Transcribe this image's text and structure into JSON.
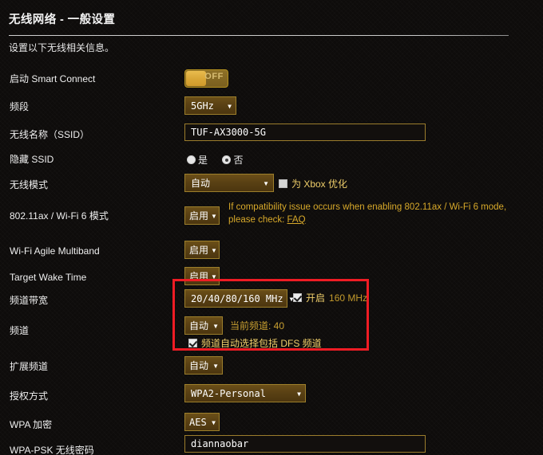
{
  "header": {
    "title": "无线网络 - 一般设置",
    "subtitle": "设置以下无线相关信息。"
  },
  "form": {
    "smart_connect": {
      "label": "启动 Smart Connect",
      "toggle_state": "OFF"
    },
    "band": {
      "label": "频段",
      "value": "5GHz"
    },
    "ssid": {
      "label": "无线名称（SSID）",
      "value": "TUF-AX3000-5G"
    },
    "hide_ssid": {
      "label": "隐藏 SSID",
      "option_yes": "是",
      "option_no": "否",
      "selected": "否"
    },
    "wireless_mode": {
      "label": "无线模式",
      "value": "自动",
      "xbox_label": "为 Xbox 优化",
      "xbox_checked": false
    },
    "ax_mode": {
      "label": "802.11ax / Wi-Fi 6 模式",
      "value": "启用",
      "hint_line1": "If compatibility issue occurs when enabling 802.11ax / Wi-Fi 6 mode,",
      "hint_line2_prefix": "please check:",
      "hint_link": "FAQ"
    },
    "agile_multiband": {
      "label": "Wi-Fi Agile Multiband",
      "value": "启用"
    },
    "target_wake_time": {
      "label": "Target Wake Time",
      "value": "启用"
    },
    "channel_bandwidth": {
      "label": "频道带宽",
      "value": "20/40/80/160 MHz",
      "enable160_label_cjk": "开启",
      "enable160_label_num": "160 MHz",
      "enable160_checked": true
    },
    "channel": {
      "label": "频道",
      "value": "自动",
      "current_note": "当前频道: 40",
      "dfs_label": "频道自动选择包括 DFS 频道",
      "dfs_checked": true
    },
    "extension_channel": {
      "label": "扩展频道",
      "value": "自动"
    },
    "auth_method": {
      "label": "授权方式",
      "value": "WPA2-Personal"
    },
    "wpa_encryption": {
      "label": "WPA 加密",
      "value": "AES"
    },
    "wpa_psk": {
      "label": "WPA-PSK 无线密码",
      "value": "diannaobar"
    }
  },
  "icons": {
    "caret_down": "▼"
  },
  "colors": {
    "accent_gold": "#d8a92a",
    "highlight_red": "#ef1c24",
    "panel_bg": "#0e0c0b"
  }
}
